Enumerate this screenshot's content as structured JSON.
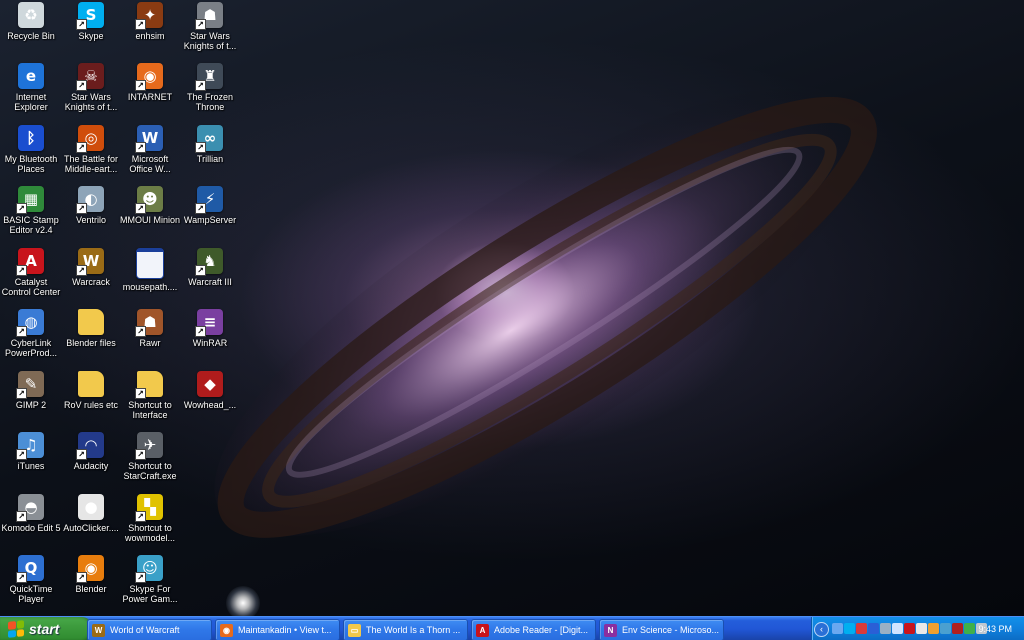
{
  "desktop": {
    "icons": [
      {
        "label": "Recycle Bin",
        "icon": "recycle-bin-icon",
        "glyph": "♻",
        "color": "#cfd8dc",
        "shortcut": false
      },
      {
        "label": "Skype",
        "icon": "skype-icon",
        "glyph": "S",
        "color": "#00aff0",
        "shortcut": true
      },
      {
        "label": "enhsim",
        "icon": "enhsim-icon",
        "glyph": "✦",
        "color": "#8a3b12",
        "shortcut": true
      },
      {
        "label": "Star Wars\nKnights of t...",
        "icon": "star-wars-icon",
        "glyph": "☗",
        "color": "#7a7f86",
        "shortcut": true
      },
      {
        "label": "Internet\nExplorer",
        "icon": "internet-explorer-icon",
        "glyph": "e",
        "color": "#1e73d8",
        "shortcut": false
      },
      {
        "label": "Star Wars\nKnights of t...",
        "icon": "star-wars-sith-icon",
        "glyph": "☠",
        "color": "#6b1d1d",
        "shortcut": true
      },
      {
        "label": "INTARNET",
        "icon": "firefox-icon",
        "glyph": "◉",
        "color": "#e66a1c",
        "shortcut": true
      },
      {
        "label": "The Frozen\nThrone",
        "icon": "frozen-throne-icon",
        "glyph": "♜",
        "color": "#3f4a57",
        "shortcut": true
      },
      {
        "label": "My Bluetooth\nPlaces",
        "icon": "bluetooth-icon",
        "glyph": "ᛒ",
        "color": "#1a4ecf",
        "shortcut": false
      },
      {
        "label": "The Battle for\nMiddle-eart...",
        "icon": "battle-middle-earth-icon",
        "glyph": "◎",
        "color": "#d04d0b",
        "shortcut": true
      },
      {
        "label": "Microsoft\nOffice W...",
        "icon": "microsoft-word-icon",
        "glyph": "W",
        "color": "#2b5fb4",
        "shortcut": true
      },
      {
        "label": "Trillian",
        "icon": "trillian-icon",
        "glyph": "∞",
        "color": "#3b8fb0",
        "shortcut": true
      },
      {
        "label": "BASIC Stamp\nEditor v2.4",
        "icon": "basic-stamp-icon",
        "glyph": "▦",
        "color": "#2f8a3a",
        "shortcut": true
      },
      {
        "label": "Ventrilo",
        "icon": "ventrilo-icon",
        "glyph": "◐",
        "color": "#8da4b8",
        "shortcut": true
      },
      {
        "label": "MMOUI Minion",
        "icon": "mmoui-minion-icon",
        "glyph": "☻",
        "color": "#6c7d46",
        "shortcut": true
      },
      {
        "label": "WampServer",
        "icon": "wampserver-icon",
        "glyph": "⚡",
        "color": "#1f5aa6",
        "shortcut": true
      },
      {
        "label": "Catalyst\nControl Center",
        "icon": "ati-catalyst-icon",
        "glyph": "A",
        "color": "#c8141c",
        "shortcut": true
      },
      {
        "label": "Warcrack",
        "icon": "world-of-warcraft-icon",
        "glyph": "W",
        "color": "#9a6b16",
        "shortcut": true
      },
      {
        "label": "mousepath....",
        "icon": "image-file-icon",
        "glyph": "",
        "color": "#f2f4fa",
        "shortcut": false
      },
      {
        "label": "Warcraft III",
        "icon": "warcraft-iii-icon",
        "glyph": "♞",
        "color": "#3f5a2a",
        "shortcut": true
      },
      {
        "label": "CyberLink\nPowerProd...",
        "icon": "cyberlink-icon",
        "glyph": "◍",
        "color": "#3a7bd5",
        "shortcut": true
      },
      {
        "label": "Blender files",
        "icon": "folder-icon",
        "glyph": "",
        "color": "#f2c94c",
        "shortcut": false
      },
      {
        "label": "Rawr",
        "icon": "rawr-icon",
        "glyph": "☗",
        "color": "#a0552a",
        "shortcut": true
      },
      {
        "label": "WinRAR",
        "icon": "winrar-icon",
        "glyph": "≡",
        "color": "#7a3fa0",
        "shortcut": true
      },
      {
        "label": "GIMP 2",
        "icon": "gimp-icon",
        "glyph": "✎",
        "color": "#7f6a55",
        "shortcut": true
      },
      {
        "label": "RoV rules etc",
        "icon": "folder-icon",
        "glyph": "",
        "color": "#f2c94c",
        "shortcut": false
      },
      {
        "label": "Shortcut to\nInterface",
        "icon": "folder-shortcut-icon",
        "glyph": "",
        "color": "#f2c94c",
        "shortcut": true
      },
      {
        "label": "Wowhead_...",
        "icon": "wowhead-icon",
        "glyph": "◆",
        "color": "#b01c1c",
        "shortcut": false
      },
      {
        "label": "iTunes",
        "icon": "itunes-icon",
        "glyph": "♫",
        "color": "#4c8fd6",
        "shortcut": true
      },
      {
        "label": "Audacity",
        "icon": "audacity-icon",
        "glyph": "◠",
        "color": "#233a8a",
        "shortcut": true
      },
      {
        "label": "Shortcut to\nStarCraft.exe",
        "icon": "starcraft-icon",
        "glyph": "✈",
        "color": "#5a5f66",
        "shortcut": true
      },
      {
        "label": "",
        "icon": "blank-icon",
        "glyph": "",
        "color": "transparent",
        "shortcut": false
      },
      {
        "label": "Komodo Edit 5",
        "icon": "komodo-icon",
        "glyph": "◓",
        "color": "#8a8f95",
        "shortcut": true
      },
      {
        "label": "AutoClicker....",
        "icon": "mouse-icon",
        "glyph": "●",
        "color": "#e6e6e6",
        "shortcut": false
      },
      {
        "label": "Shortcut to\nwowmodel...",
        "icon": "wowmodelviewer-icon",
        "glyph": "▚",
        "color": "#e0c200",
        "shortcut": true
      },
      {
        "label": "",
        "icon": "blank-icon",
        "glyph": "",
        "color": "transparent",
        "shortcut": false
      },
      {
        "label": "QuickTime\nPlayer",
        "icon": "quicktime-icon",
        "glyph": "Q",
        "color": "#2d6fd1",
        "shortcut": true
      },
      {
        "label": "Blender",
        "icon": "blender-icon",
        "glyph": "◉",
        "color": "#e87d0d",
        "shortcut": true
      },
      {
        "label": "Skype For\nPower Gam...",
        "icon": "skype-power-gamer-icon",
        "glyph": "☺",
        "color": "#3aa0c8",
        "shortcut": true
      },
      {
        "label": "",
        "icon": "blank-icon",
        "glyph": "",
        "color": "transparent",
        "shortcut": false
      }
    ]
  },
  "taskbar": {
    "start_label": "start",
    "buttons": [
      {
        "label": "World of Warcraft",
        "icon": "world-of-warcraft-icon",
        "color": "#9a6b16",
        "glyph": "W"
      },
      {
        "label": "Maintankadin • View t...",
        "icon": "firefox-icon",
        "color": "#e66a1c",
        "glyph": "◉"
      },
      {
        "label": "The World Is a Thorn ...",
        "icon": "folder-icon",
        "color": "#f2c94c",
        "glyph": "▭"
      },
      {
        "label": "Adobe Reader - [Digit...",
        "icon": "adobe-reader-icon",
        "color": "#c8141c",
        "glyph": "A"
      },
      {
        "label": "Env Science - Microso...",
        "icon": "onenote-icon",
        "color": "#8a2fa0",
        "glyph": "N"
      }
    ],
    "tray": {
      "toggle_glyph": "‹",
      "icons": [
        {
          "icon": "network-icon",
          "color": "#6aa8f0"
        },
        {
          "icon": "skype-tray-icon",
          "color": "#00aff0"
        },
        {
          "icon": "shield-icon",
          "color": "#d93a3a"
        },
        {
          "icon": "bluetooth-tray-icon",
          "color": "#2a5fd6"
        },
        {
          "icon": "ventrilo-tray-icon",
          "color": "#9ab0c4"
        },
        {
          "icon": "wifi-icon",
          "color": "#d0e4ff"
        },
        {
          "icon": "ati-tray-icon",
          "color": "#c8141c"
        },
        {
          "icon": "volume-icon",
          "color": "#e8e8e8"
        },
        {
          "icon": "wamp-tray-icon",
          "color": "#f0a030"
        },
        {
          "icon": "trillian-tray-icon",
          "color": "#4aa0d0"
        },
        {
          "icon": "antivirus-icon",
          "color": "#b02020"
        },
        {
          "icon": "messenger-icon",
          "color": "#3fb04a"
        },
        {
          "icon": "safely-remove-icon",
          "color": "#c0c8d0"
        }
      ]
    },
    "clock": "9:43 PM"
  }
}
